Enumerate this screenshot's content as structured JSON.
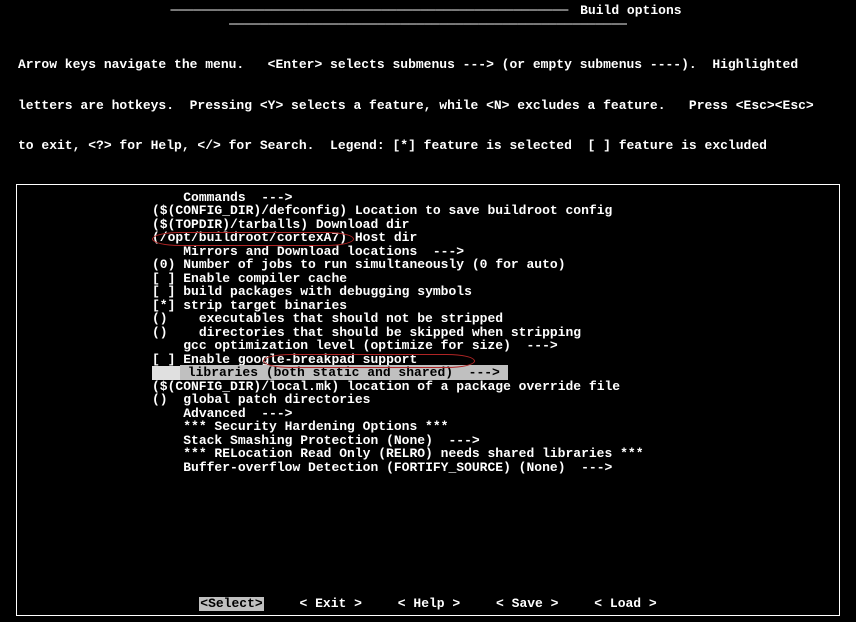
{
  "title": "Build options",
  "help_lines": [
    "Arrow keys navigate the menu.   <Enter> selects submenus ---> (or empty submenus ----).  Highlighted",
    "letters are hotkeys.  Pressing <Y> selects a feature, while <N> excludes a feature.   Press <Esc><Esc>",
    "to exit, <?> for Help, </> for Search.  Legend: [*] feature is selected  [ ] feature is excluded"
  ],
  "menu": [
    {
      "prefix": "    ",
      "hk": "C",
      "text": "ommands  --->"
    },
    {
      "prefix": "($(CONFIG_DIR)/defconfig) ",
      "hk": "L",
      "text": "ocation to save buildroot config"
    },
    {
      "prefix": "($(TOPDIR)/tarballs) ",
      "hk": "D",
      "text": "ownload dir"
    },
    {
      "prefix": "(/opt/buildroot/cortexA7) H",
      "hk": "o",
      "text": "st dir"
    },
    {
      "prefix": "    ",
      "hk": "M",
      "text": "irrors and Download locations  --->"
    },
    {
      "prefix": "(0) ",
      "hk": "N",
      "text": "umber of jobs to run simultaneously (0 for auto)"
    },
    {
      "prefix": "[ ] ",
      "hk": "E",
      "text": "nable compiler cache"
    },
    {
      "prefix": "[ ] ",
      "hk": "b",
      "text": "uild packages with debugging symbols"
    },
    {
      "prefix": "[*] ",
      "hk": "s",
      "text": "trip target binaries"
    },
    {
      "prefix": "()    ",
      "hk": "e",
      "text": "xecutables that should not be stripped"
    },
    {
      "prefix": "()    ",
      "hk": "d",
      "text": "irectories that should be skipped when stripping"
    },
    {
      "prefix": "    ",
      "hk": "g",
      "text": "cc optimization level (optimize for size)  --->"
    },
    {
      "prefix": "[ ] ",
      "hk": "E",
      "text": "nable google-breakpad support"
    },
    {
      "prefix": "    ",
      "hk": "l",
      "text": "ibraries (both static and shared)  --->",
      "selected": true
    },
    {
      "prefix": "($(CONFIG_DIR)/local.mk) ",
      "hk": "l",
      "text": "ocation of a package override file"
    },
    {
      "prefix": "()  ",
      "hk": "g",
      "text": "lobal patch directories"
    },
    {
      "prefix": "    ",
      "hk": "A",
      "text": "dvanced  --->"
    },
    {
      "prefix": "    ",
      "hk": "",
      "text": "*** Security Hardening Options ***"
    },
    {
      "prefix": "    ",
      "hk": "S",
      "text": "tack Smashing Protection (None)  --->"
    },
    {
      "prefix": "    ",
      "hk": "",
      "text": "*** RELocation Read Only (RELRO) needs shared libraries ***"
    },
    {
      "prefix": "    ",
      "hk": "B",
      "text": "uffer-overflow Detection (FORTIFY_SOURCE) (None)  --->"
    }
  ],
  "buttons": {
    "select": "<Select>",
    "exit_pre": "< E",
    "exit_hk": "x",
    "exit_post": "it >",
    "help_pre": "< ",
    "help_hk": "H",
    "help_post": "elp >",
    "save_pre": "< ",
    "save_hk": "S",
    "save_post": "ave >",
    "load_pre": "< ",
    "load_hk": "L",
    "load_post": "oad >"
  }
}
